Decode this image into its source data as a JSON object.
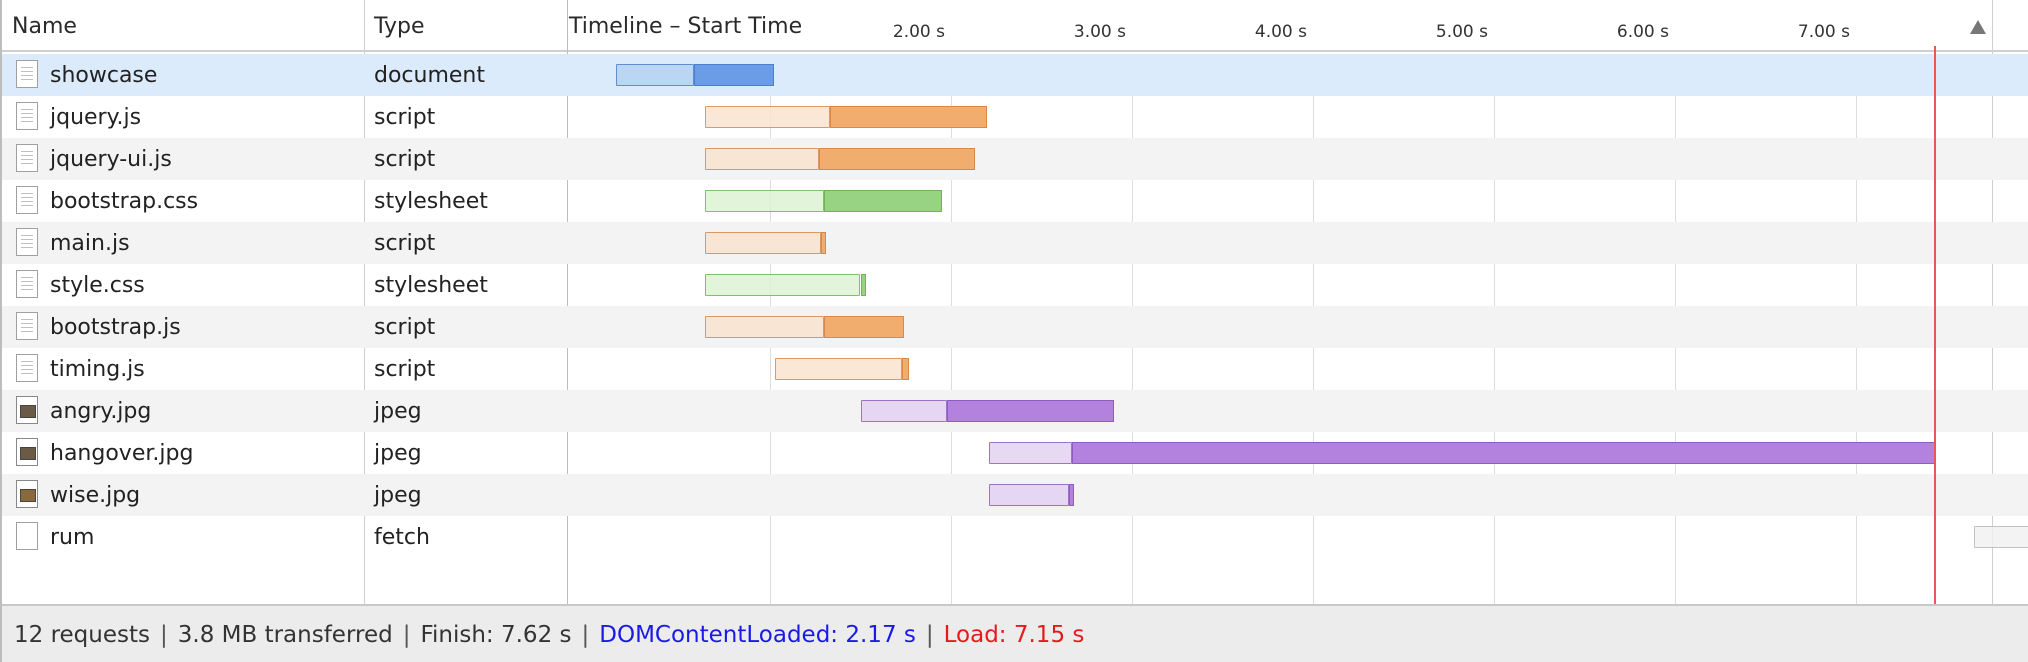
{
  "header": {
    "name_col": "Name",
    "type_col": "Type",
    "timeline_col": "Timeline – Start Time"
  },
  "ticks": [
    {
      "label": "2.00 s",
      "value": 2
    },
    {
      "label": "3.00 s",
      "value": 3
    },
    {
      "label": "4.00 s",
      "value": 4
    },
    {
      "label": "5.00 s",
      "value": 5
    },
    {
      "label": "6.00 s",
      "value": 6
    },
    {
      "label": "7.00 s",
      "value": 7
    }
  ],
  "requests": [
    {
      "name": "showcase",
      "type": "document",
      "icon": "document-icon",
      "start": 0.15,
      "waiting_end": 0.58,
      "end": 1.02,
      "color": "document"
    },
    {
      "name": "jquery.js",
      "type": "script",
      "icon": "document-icon",
      "start": 0.64,
      "waiting_end": 1.33,
      "end": 2.2,
      "color": "script"
    },
    {
      "name": "jquery-ui.js",
      "type": "script",
      "icon": "document-icon",
      "start": 0.64,
      "waiting_end": 1.27,
      "end": 2.13,
      "color": "script"
    },
    {
      "name": "bootstrap.css",
      "type": "stylesheet",
      "icon": "document-icon",
      "start": 0.64,
      "waiting_end": 1.3,
      "end": 1.95,
      "color": "stylesheet"
    },
    {
      "name": "main.js",
      "type": "script",
      "icon": "document-icon",
      "start": 0.64,
      "waiting_end": 1.28,
      "end": 1.31,
      "color": "script"
    },
    {
      "name": "style.css",
      "type": "stylesheet",
      "icon": "document-icon",
      "start": 0.64,
      "waiting_end": 1.5,
      "end": 1.53,
      "color": "stylesheet"
    },
    {
      "name": "bootstrap.js",
      "type": "script",
      "icon": "document-icon",
      "start": 0.64,
      "waiting_end": 1.3,
      "end": 1.74,
      "color": "script"
    },
    {
      "name": "timing.js",
      "type": "script",
      "icon": "document-icon",
      "start": 1.03,
      "waiting_end": 1.73,
      "end": 1.77,
      "color": "script"
    },
    {
      "name": "angry.jpg",
      "type": "jpeg",
      "icon": "image-icon",
      "start": 1.5,
      "waiting_end": 1.98,
      "end": 2.9,
      "color": "image"
    },
    {
      "name": "hangover.jpg",
      "type": "jpeg",
      "icon": "image-icon",
      "start": 2.21,
      "waiting_end": 2.67,
      "end": 7.44,
      "color": "image"
    },
    {
      "name": "wise.jpg",
      "type": "jpeg",
      "icon": "image-icon",
      "start": 2.21,
      "waiting_end": 2.65,
      "end": 2.68,
      "color": "image"
    },
    {
      "name": "rum",
      "type": "fetch",
      "icon": "blank-file-icon",
      "start": 7.65,
      "waiting_end": 8.06,
      "end": 8.09,
      "color": "other"
    }
  ],
  "load_marker": 7.15,
  "colors": {
    "document": {
      "light": "#b6d2f5",
      "dark": "#6a9de6",
      "border": "#4a80cc"
    },
    "script": {
      "light": "#fae3ce",
      "dark": "#f0ad6e",
      "border": "#d9884a"
    },
    "stylesheet": {
      "light": "#def3d4",
      "dark": "#97d383",
      "border": "#6fb35a"
    },
    "image": {
      "light": "#e3d3f3",
      "dark": "#b282de",
      "border": "#8d5cc4"
    },
    "other": {
      "light": "#f1f1f1",
      "dark": "#d8d8d8",
      "border": "#b8b8b8"
    },
    "load_line": "#ee5555"
  },
  "footer": {
    "requests": "12 requests",
    "transferred": "3.8 MB transferred",
    "finish": "Finish: 7.62 s",
    "dom": "DOMContentLoaded: 2.17 s",
    "load": "Load: 7.15 s"
  }
}
